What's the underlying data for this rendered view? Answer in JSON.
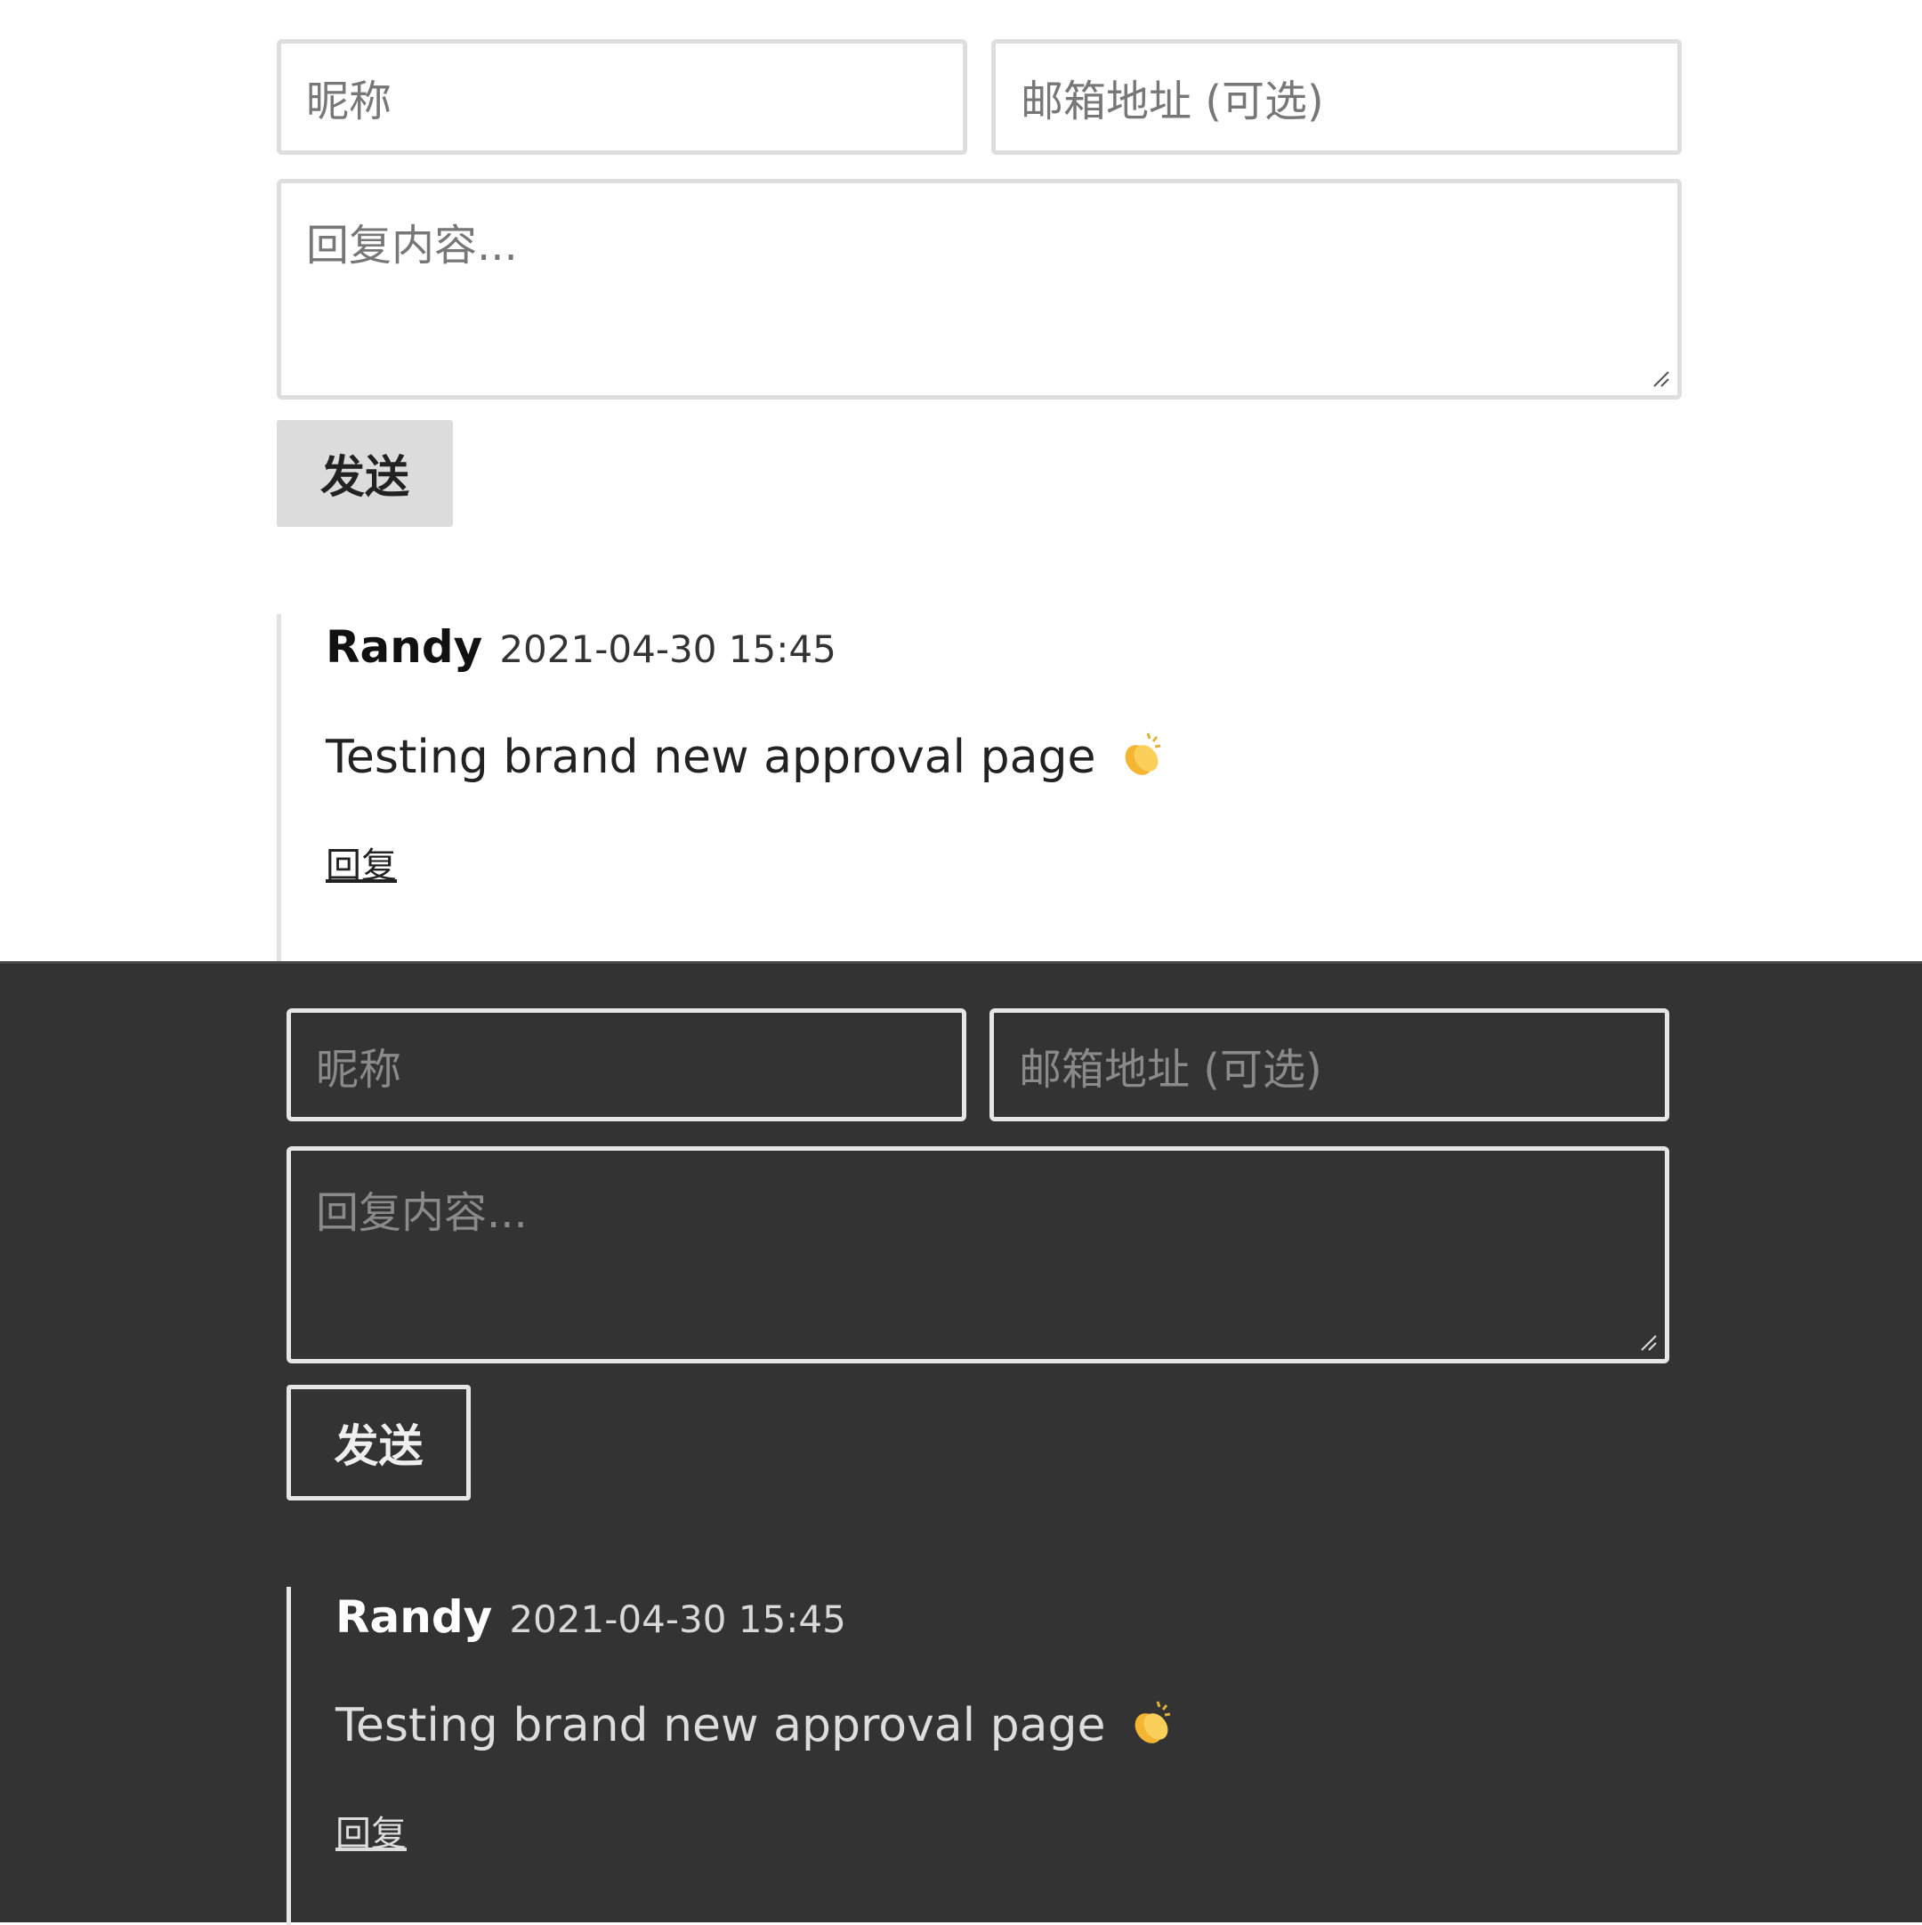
{
  "form": {
    "nickname_placeholder": "昵称",
    "email_placeholder": "邮箱地址 (可选)",
    "content_placeholder": "回复内容...",
    "submit_label": "发送"
  },
  "comment": {
    "author": "Randy",
    "timestamp": "2021-04-30 15:45",
    "body": "Testing brand new approval page",
    "emoji": "clapping-hands-icon",
    "reply_label": "回复"
  },
  "themes": {
    "light": {
      "background": "#ffffff",
      "border": "#dedede",
      "button": "#dcdcdc"
    },
    "dark": {
      "background": "#333333",
      "border": "#e6e6e6",
      "button": "#333333"
    }
  }
}
